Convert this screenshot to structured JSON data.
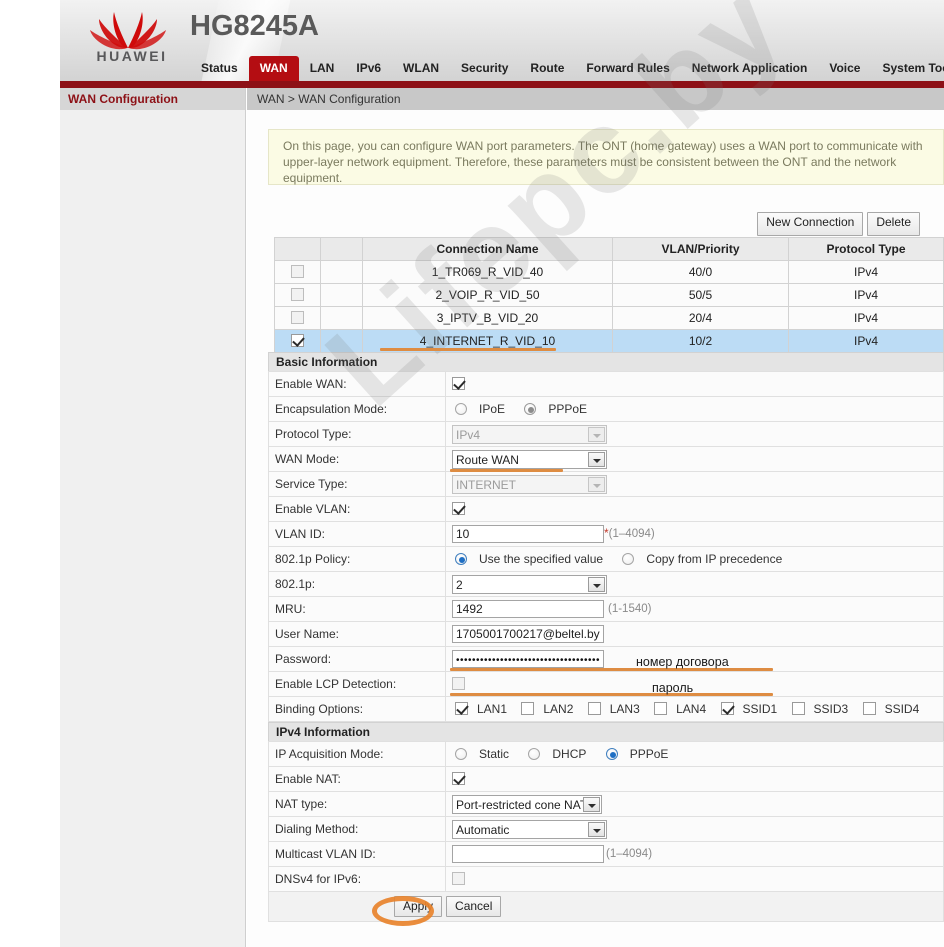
{
  "header": {
    "brand": "HUAWEI",
    "model": "HG8245A",
    "nav": [
      {
        "label": "Status",
        "active": false
      },
      {
        "label": "WAN",
        "active": true
      },
      {
        "label": "LAN",
        "active": false
      },
      {
        "label": "IPv6",
        "active": false
      },
      {
        "label": "WLAN",
        "active": false
      },
      {
        "label": "Security",
        "active": false
      },
      {
        "label": "Route",
        "active": false
      },
      {
        "label": "Forward Rules",
        "active": false
      },
      {
        "label": "Network Application",
        "active": false
      },
      {
        "label": "Voice",
        "active": false
      },
      {
        "label": "System Tools",
        "active": false
      }
    ]
  },
  "sidebar": {
    "header": "WAN Configuration"
  },
  "breadcrumb": "WAN > WAN Configuration",
  "notice": "On this page, you can configure WAN port parameters. The ONT (home gateway) uses a WAN port to communicate with upper-layer network equipment. Therefore, these parameters must be consistent between the ONT and the network equipment.",
  "toolbar": {
    "new_connection": "New Connection",
    "delete": "Delete"
  },
  "connection_table": {
    "columns": [
      "Connection Name",
      "VLAN/Priority",
      "Protocol Type"
    ],
    "rows": [
      {
        "checked": false,
        "name": "1_TR069_R_VID_40",
        "vlan": "40/0",
        "protocol": "IPv4"
      },
      {
        "checked": false,
        "name": "2_VOIP_R_VID_50",
        "vlan": "50/5",
        "protocol": "IPv4"
      },
      {
        "checked": false,
        "name": "3_IPTV_B_VID_20",
        "vlan": "20/4",
        "protocol": "IPv4"
      },
      {
        "checked": true,
        "name": "4_INTERNET_R_VID_10",
        "vlan": "10/2",
        "protocol": "IPv4"
      }
    ]
  },
  "basic": {
    "title": "Basic Information",
    "enable_wan_label": "Enable WAN:",
    "encapsulation_label": "Encapsulation Mode:",
    "encapsulation_ipoe": "IPoE",
    "encapsulation_pppoe": "PPPoE",
    "protocol_type_label": "Protocol Type:",
    "protocol_type_value": "IPv4",
    "wan_mode_label": "WAN Mode:",
    "wan_mode_value": "Route WAN",
    "service_type_label": "Service Type:",
    "service_type_value": "INTERNET",
    "enable_vlan_label": "Enable VLAN:",
    "vlan_id_label": "VLAN ID:",
    "vlan_id_value": "10",
    "vlan_id_hint": "(1–4094)",
    "policy_label": "802.1p Policy:",
    "policy_specified": "Use the specified value",
    "policy_copy": "Copy from IP precedence",
    "dot1p_label": "802.1p:",
    "dot1p_value": "2",
    "mru_label": "MRU:",
    "mru_value": "1492",
    "mru_hint": "(1-1540)",
    "username_label": "User Name:",
    "username_value": "1705001700217@beltel.by",
    "password_label": "Password:",
    "password_value": "••••••••••••••••••••••••••••••••••••",
    "lcp_label": "Enable LCP Detection:",
    "binding_label": "Binding Options:",
    "binding": [
      {
        "label": "LAN1",
        "checked": true
      },
      {
        "label": "LAN2",
        "checked": false
      },
      {
        "label": "LAN3",
        "checked": false
      },
      {
        "label": "LAN4",
        "checked": false
      },
      {
        "label": "SSID1",
        "checked": true
      },
      {
        "label": "SSID3",
        "checked": false
      },
      {
        "label": "SSID4",
        "checked": false
      }
    ]
  },
  "ipv4": {
    "title": "IPv4 Information",
    "acquisition_label": "IP Acquisition Mode:",
    "acq_static": "Static",
    "acq_dhcp": "DHCP",
    "acq_pppoe": "PPPoE",
    "enable_nat_label": "Enable NAT:",
    "nat_type_label": "NAT type:",
    "nat_type_value": "Port-restricted cone NAT",
    "dialing_label": "Dialing Method:",
    "dialing_value": "Automatic",
    "mcast_label": "Multicast VLAN ID:",
    "mcast_value": "",
    "mcast_hint": "(1–4094)",
    "dnsv4_label": "DNSv4 for IPv6:"
  },
  "footer": {
    "apply": "Apply",
    "cancel": "Cancel"
  },
  "annotations": {
    "username_note": "номер договора",
    "password_note": "пароль",
    "highlight_color": "#de8c42"
  },
  "watermark": "Lifepc.by"
}
